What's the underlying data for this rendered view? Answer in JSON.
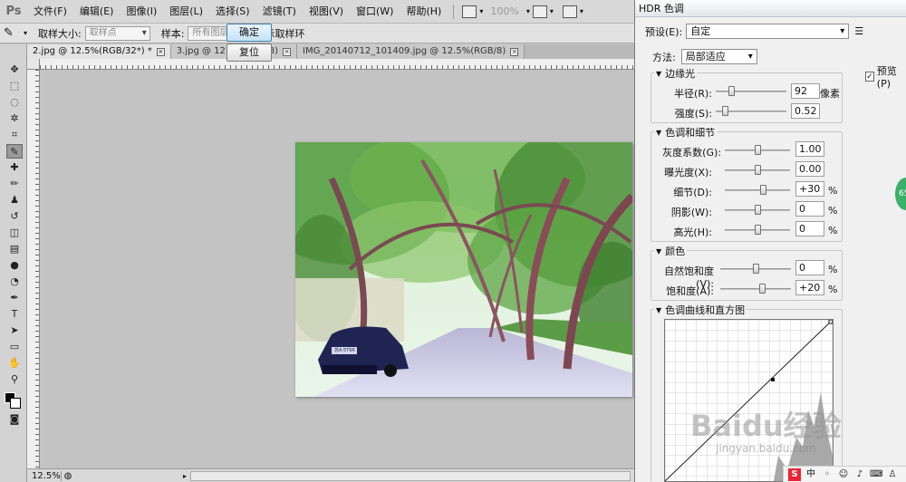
{
  "app": {
    "logo": "Ps",
    "menu": [
      "文件(F)",
      "编辑(E)",
      "图像(I)",
      "图层(L)",
      "选择(S)",
      "滤镜(T)",
      "视图(V)",
      "窗口(W)",
      "帮助(H)"
    ],
    "zoom_readout": "100%"
  },
  "options_bar": {
    "sample_size_label": "取样大小:",
    "sample_size_value": "取样点",
    "sample_label": "样本:",
    "sample_value": "所有图层",
    "show_ring_label": "显示取样环",
    "show_ring_checked": true
  },
  "tabs": [
    {
      "label": "2.jpg @ 12.5%(RGB/32*) *",
      "active": true
    },
    {
      "label": "3.jpg @ 12.5%(RGB/8)",
      "active": false
    },
    {
      "label": "IMG_20140712_101409.jpg @ 12.5%(RGB/8)",
      "active": false
    }
  ],
  "status": {
    "zoom": "12.5%"
  },
  "hdr": {
    "title": "HDR 色调",
    "preset_label": "预设(E):",
    "preset_value": "自定",
    "ok_label": "确定",
    "reset_label": "复位",
    "preview_label": "预览(P)",
    "preview_checked": true,
    "method_label": "方法:",
    "method_value": "局部适应",
    "edge_glow": {
      "title": "边缘光",
      "radius_label": "半径(R):",
      "radius_value": "92",
      "radius_unit": "像素",
      "radius_level": 0.2,
      "strength_label": "强度(S):",
      "strength_value": "0.52",
      "strength_level": 0.1
    },
    "tone_detail": {
      "title": "色调和细节",
      "gamma_label": "灰度系数(G):",
      "gamma_value": "1.00",
      "gamma_level": 0.5,
      "exposure_label": "曝光度(X):",
      "exposure_value": "0.00",
      "exposure_level": 0.5,
      "detail_label": "细节(D):",
      "detail_value": "+30",
      "detail_level": 0.6,
      "shadow_label": "阴影(W):",
      "shadow_value": "0",
      "shadow_level": 0.5,
      "highlight_label": "高光(H):",
      "highlight_value": "0",
      "highlight_level": 0.5
    },
    "color": {
      "title": "颜色",
      "vibrance_label": "自然饱和度(V):",
      "vibrance_value": "0",
      "vibrance_level": 0.5,
      "saturation_label": "饱和度(A):",
      "saturation_value": "+20",
      "saturation_level": 0.6
    },
    "percent": "%",
    "curve_title": "色调曲线和直方图"
  },
  "overlay": {
    "badge": "65",
    "watermark": "Baidu经验",
    "watermark_url": "jingyan.baidu.com",
    "license_plate": "苏A·5T6R"
  }
}
